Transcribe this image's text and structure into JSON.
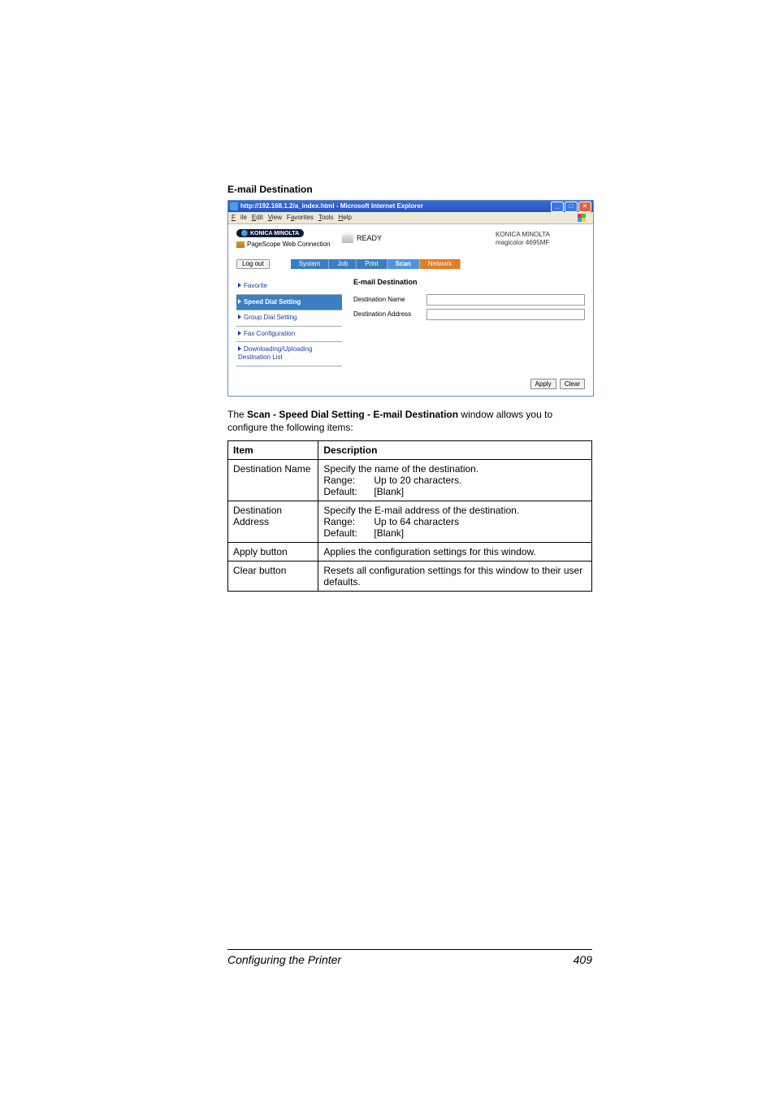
{
  "section_heading": "E-mail Destination",
  "screenshot": {
    "window_title": "http://192.168.1.2/a_index.html - Microsoft Internet Explorer",
    "menu": {
      "file": "File",
      "edit": "Edit",
      "view": "View",
      "favorites": "Favorites",
      "tools": "Tools",
      "help": "Help"
    },
    "brand": "KONICA MINOLTA",
    "pagescope": "PageScope Web Connection",
    "status": "READY",
    "device_brand": "KONICA MINOLTA",
    "device_model": "magicolor 4695MF",
    "logout": "Log out",
    "tabs": {
      "system": "System",
      "job": "Job",
      "print": "Print",
      "scan": "Scan",
      "network": "Network"
    },
    "nav": {
      "favorite": "Favorite",
      "speed_dial": "Speed Dial Setting",
      "group_dial": "Group Dial Setting",
      "fax_config": "Fax Configuration",
      "download": "Downloading/Uploading Destination List"
    },
    "panel": {
      "title": "E-mail Destination",
      "dest_name_label": "Destination Name",
      "dest_addr_label": "Destination Address"
    },
    "buttons": {
      "apply": "Apply",
      "clear": "Clear"
    }
  },
  "intro": {
    "prefix": "The ",
    "bold": "Scan - Speed Dial Setting - E-mail Destination",
    "suffix": " window allows you to configure the following items:"
  },
  "table": {
    "headers": {
      "item": "Item",
      "description": "Description"
    },
    "rows": [
      {
        "item": "Destination Name",
        "desc_main": "Specify the name of the destination.",
        "range_label": "Range:",
        "range_value": "Up to 20 characters.",
        "default_label": "Default:",
        "default_value": "[Blank]"
      },
      {
        "item": "Destination Address",
        "desc_main": "Specify the E-mail address of the destination.",
        "range_label": "Range:",
        "range_value": "Up to 64 characters",
        "default_label": "Default:",
        "default_value": "[Blank]"
      },
      {
        "item": "Apply button",
        "desc_main": "Applies the configuration settings for this window."
      },
      {
        "item": "Clear button",
        "desc_main": "Resets all configuration settings for this window to their user defaults."
      }
    ]
  },
  "footer": {
    "title": "Configuring the Printer",
    "page": "409"
  }
}
